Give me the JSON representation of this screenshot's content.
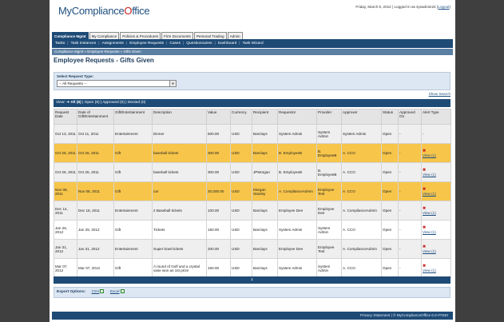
{
  "header": {
    "logo_main": "MyCompliance",
    "logo_o": "O",
    "logo_tail": "ffice",
    "date": "Friday, March 9, 2012",
    "logged_in_text": "Logged in as sysadmin24",
    "logout": "Logout"
  },
  "tabs": [
    {
      "label": "Compliance Mgmt",
      "active": true
    },
    {
      "label": "My Compliance"
    },
    {
      "label": "Policies & Procedures"
    },
    {
      "label": "Firm Documents"
    },
    {
      "label": "Personal Trading"
    },
    {
      "label": "Admin"
    }
  ],
  "nav": [
    "Tasks",
    "Task Instances",
    "Assignments",
    "Employee Requests",
    "Cases",
    "Questionnaires",
    "Dashboard",
    "Task Wizard"
  ],
  "breadcrumb": "Compliance Mgmt » Employee Requests » Gifts Given",
  "page_title": "Employee Requests - Gifts Given",
  "filter": {
    "label": "Select Request Type:",
    "selected": "-- All Requests --"
  },
  "show_search": "Show Search",
  "view_bar": {
    "prefix": "View:",
    "current": "All (8)",
    "rest": " | Open (8) | Approved (0) | Denied (0)"
  },
  "columns": [
    "Request Date",
    "Date of Gift/Entertainment",
    "Gift/Entertainment",
    "Description",
    "Value",
    "Currency",
    "Recipient",
    "Requestor",
    "Provider",
    "Approver",
    "Status",
    "Approved On",
    "Alert Type"
  ],
  "rows": [
    {
      "req": "Oct 13, 2011",
      "date": "Oct 11, 2011",
      "type": "Entertainment",
      "desc": "Dinner",
      "value": "500.00",
      "cur": "USD",
      "recipient": "Barclays",
      "requestor": "System Admin",
      "provider": "System Admin",
      "approver": "System Admin",
      "status": "Open",
      "approved": "-",
      "alert": "-",
      "highlight": false
    },
    {
      "req": "Oct 25, 2011",
      "date": "Oct 25, 2011",
      "type": "Gift",
      "desc": "baseball tickets",
      "value": "300.00",
      "cur": "USD",
      "recipient": "Barclays",
      "requestor": "B. EmployeeB",
      "provider": "B. EmployeeB",
      "approver": "A. CCO",
      "status": "Open",
      "approved": "-",
      "alert": "View (1)",
      "highlight": true
    },
    {
      "req": "Oct 25, 2011",
      "date": "Oct 25, 2011",
      "type": "Gift",
      "desc": "baseball tickets",
      "value": "300.00",
      "cur": "USD",
      "recipient": "JPMorgan",
      "requestor": "B. EmployeeB",
      "provider": "B. EmployeeB",
      "approver": "A. CCO",
      "status": "Open",
      "approved": "-",
      "alert": "View (1)",
      "highlight": false
    },
    {
      "req": "Nov 08, 2011",
      "date": "Nov 08, 2011",
      "type": "Gift",
      "desc": "car",
      "value": "20,000.00",
      "cur": "USD",
      "recipient": "Morgan Stanley",
      "requestor": "A. ComplianceAdmin",
      "provider": "Employee Test",
      "approver": "A. CCO",
      "status": "Open",
      "approved": "-",
      "alert": "View (1)",
      "highlight": true
    },
    {
      "req": "Dec 14, 2011",
      "date": "Dec 16, 2011",
      "type": "Entertainment",
      "desc": "2 Baseball tickets",
      "value": "100.00",
      "cur": "USD",
      "recipient": "Barclays",
      "requestor": "Employee Dee",
      "provider": "Employee Dee",
      "approver": "A. ComplianceAdmin",
      "status": "Open",
      "approved": "-",
      "alert": "View (1)",
      "highlight": false
    },
    {
      "req": "Jan 26, 2012",
      "date": "Jan 25, 2012",
      "type": "Gift",
      "desc": "Tickets",
      "value": "150.00",
      "cur": "USD",
      "recipient": "Barclays",
      "requestor": "System Admin",
      "provider": "System Admin",
      "approver": "A. CCO",
      "status": "Open",
      "approved": "-",
      "alert": "View (1)",
      "highlight": false
    },
    {
      "req": "Jan 31, 2012",
      "date": "Jan 31, 2012",
      "type": "Entertainment",
      "desc": "Super bowl tickets",
      "value": "200.00",
      "cur": "USD",
      "recipient": "Barclays",
      "requestor": "Employee Dee",
      "provider": "Employee Test",
      "approver": "A. ComplianceAdmin",
      "status": "Open",
      "approved": "-",
      "alert": "View (1)",
      "highlight": false
    },
    {
      "req": "Mar 07, 2012",
      "date": "Mar 07, 2012",
      "type": "Gift",
      "desc": "A round of Golf and a crystal vase won as 1st prize",
      "value": "150.00",
      "cur": "USD",
      "recipient": "Barclays",
      "requestor": "System Admin",
      "provider": "System Admin",
      "approver": "A. CCO",
      "status": "Open",
      "approved": "-",
      "alert": "View (1)",
      "highlight": false
    }
  ],
  "pager": "1",
  "export": {
    "label": "Export Options:",
    "csv": "CSV",
    "excel": "Excel"
  },
  "footer": "Privacy Statement  |  © MyComplianceOffice 6.0-#7640",
  "colors": {
    "nav": "#1e4b76",
    "highlight": "#f7c54a",
    "alert": "#c8201f",
    "background": "#3f3f3f"
  }
}
